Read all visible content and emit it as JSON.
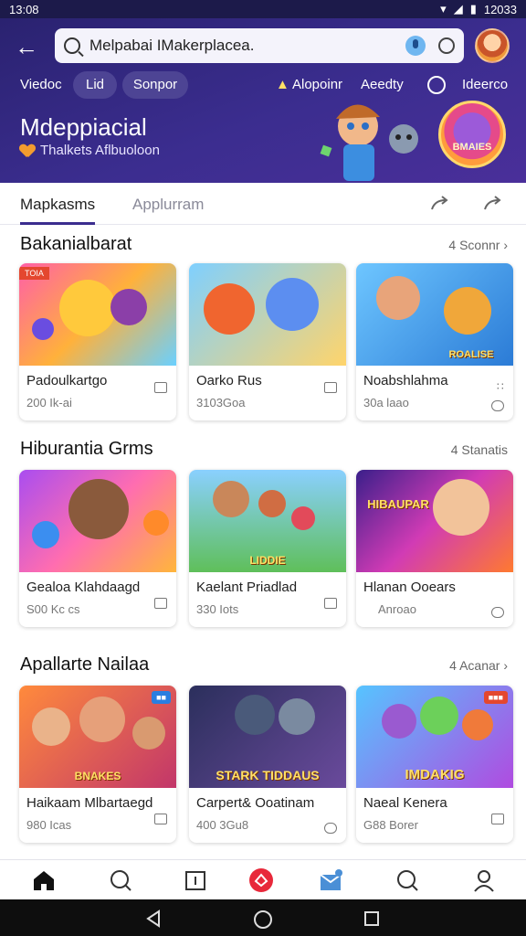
{
  "status": {
    "time": "13:08",
    "right_text": "12033"
  },
  "search": {
    "query": "Melpabai IMakerplacea."
  },
  "chips": {
    "text1": "Viedoc",
    "chip1": "Lid",
    "chip2": "Sonpor",
    "link1": "Alopoinr",
    "link2": "Aeedty",
    "link3": "Ideerco"
  },
  "hero": {
    "title": "Mdeppiacial",
    "subtitle": "Thalkets Aflbuoloon",
    "badge": "BMAIES"
  },
  "tabs": {
    "active": "Mapkasms",
    "inactive": "Applurram"
  },
  "sections": [
    {
      "title": "Bakanialbarat",
      "more": "4 Sconnr",
      "cards": [
        {
          "title": "Padoulkartgo",
          "sub": "200 Ik-ai",
          "tag": "TOIA",
          "logo": ""
        },
        {
          "title": "Oarko Rus",
          "sub": "3103Goa",
          "tag": "",
          "logo": ""
        },
        {
          "title": "Noabshlahma",
          "sub": "30a laao",
          "tag": "",
          "logo": "ROALISE"
        }
      ]
    },
    {
      "title": "Hiburantia Grms",
      "more": "4 Stanatis",
      "cards": [
        {
          "title": "Gealoa Klahdaagd",
          "sub": "S00 Kc cs",
          "tag": "",
          "logo": ""
        },
        {
          "title": "Kaelant Priadlad",
          "sub": "330 Iots",
          "tag": "",
          "logo": "LIDDIE"
        },
        {
          "title": "Hlanan Ooears",
          "sub": "Anroao",
          "tag": "",
          "logo": "HIBAUPAR"
        }
      ]
    },
    {
      "title": "Apallarte Nailaa",
      "more": "4 Acanar",
      "cards": [
        {
          "title": "Haikaam Mlbartaegd",
          "sub": "980 Icas",
          "tag": "",
          "logo": "BNAKES"
        },
        {
          "title": "Carpert& Ooatinam",
          "sub": "400 3Gu8",
          "tag": "",
          "logo": "STARK TIDDAUS"
        },
        {
          "title": "Naeal Kenera",
          "sub": "G88 Borer",
          "tag": "",
          "logo": "IMDAKIG"
        }
      ]
    }
  ],
  "colors": {
    "accent": "#3b2d8f",
    "nav_center": "#e8283a"
  }
}
